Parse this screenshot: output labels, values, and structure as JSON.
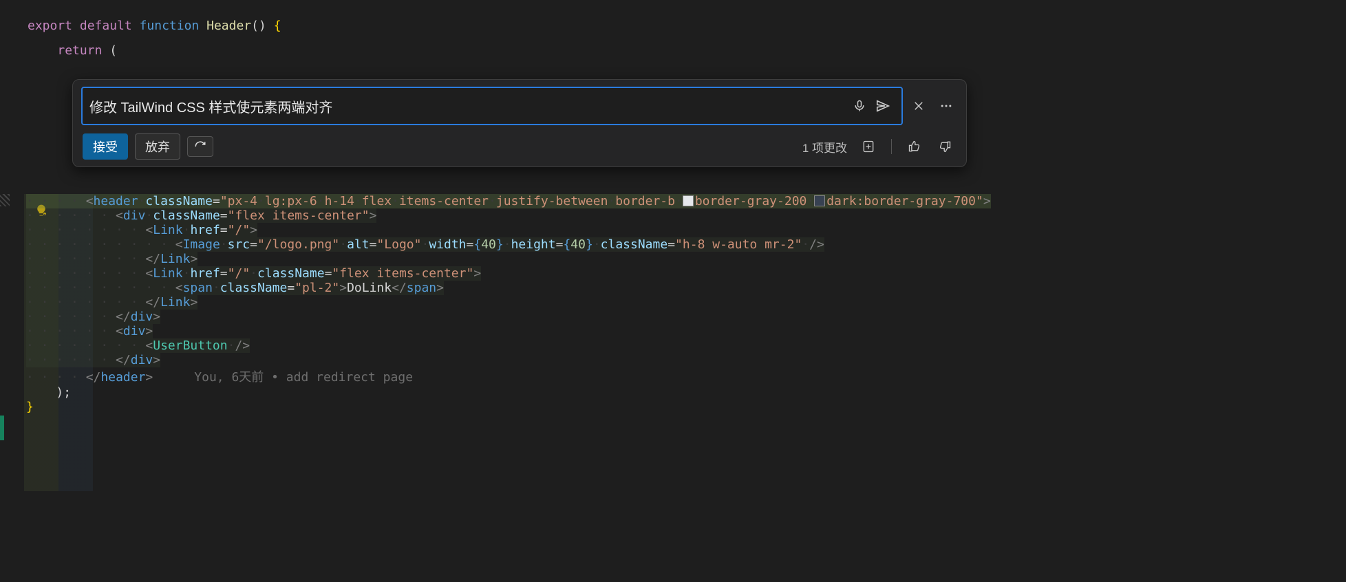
{
  "top_code": {
    "export": "export",
    "default": "default",
    "function": "function",
    "fn": "Header",
    "parens": "()",
    "open_brace": "{",
    "return": "return",
    "open_paren": "("
  },
  "panel": {
    "prompt": "修改 TailWind CSS 样式使元素两端对齐",
    "accept": "接受",
    "reject": "放弃",
    "changes": "1 项更改"
  },
  "code": {
    "header_class": "px-4",
    "header_class_rest": "lg:px-6 h-14 flex items-center justify-between border-b",
    "border_light": "border-gray-200",
    "border_dark": "dark:border-gray-700",
    "div1_class": "flex items-center",
    "link_href": "/",
    "img_src": "/logo.png",
    "img_alt": "Logo",
    "img_wh": "40",
    "img_class": "h-8 w-auto mr-2",
    "link2_class": "flex items-center",
    "span_class": "pl-2",
    "span_text": "DoLink",
    "userbtn": "UserButton",
    "blame": "You, 6天前 • add redirect page"
  },
  "tags": {
    "header": "header",
    "div": "div",
    "Link": "Link",
    "Image": "Image",
    "span": "span"
  }
}
